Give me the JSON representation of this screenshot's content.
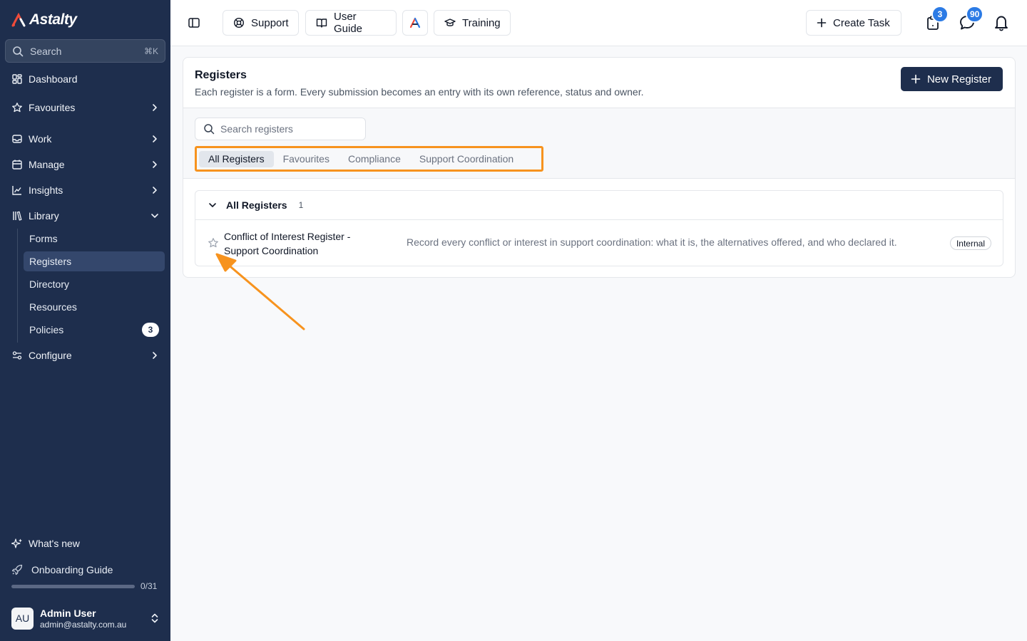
{
  "app": {
    "logo_text": "Astalty"
  },
  "sidebar": {
    "search": {
      "placeholder": "Search",
      "shortcut": "⌘K"
    },
    "items": [
      {
        "label": "Dashboard",
        "icon": "grid-icon"
      },
      {
        "label": "Favourites",
        "icon": "star-icon"
      },
      {
        "label": "Work",
        "icon": "inbox-icon"
      },
      {
        "label": "Manage",
        "icon": "calendar-icon"
      },
      {
        "label": "Insights",
        "icon": "chart-line-icon"
      },
      {
        "label": "Library",
        "icon": "library-icon"
      },
      {
        "label": "Configure",
        "icon": "sliders-icon"
      }
    ],
    "library_sub": [
      {
        "label": "Forms"
      },
      {
        "label": "Registers"
      },
      {
        "label": "Directory"
      },
      {
        "label": "Resources"
      },
      {
        "label": "Policies",
        "count": "3"
      }
    ],
    "whats_new": "What's new",
    "onboarding": {
      "label": "Onboarding Guide",
      "progress_text": "0/31",
      "progress": 0
    },
    "user": {
      "initials": "AU",
      "name": "Admin User",
      "email": "admin@astalty.com.au"
    }
  },
  "topbar": {
    "support": "Support",
    "user_guide": "User Guide",
    "training": "Training",
    "create_task": "Create Task",
    "tasks_badge": "3",
    "messages_badge": "90"
  },
  "page": {
    "title": "Registers",
    "subtitle": "Each register is a form. Every submission becomes an entry with its own reference, status and owner.",
    "new_button": "New Register",
    "search_placeholder": "Search registers",
    "tabs": [
      "All Registers",
      "Favourites",
      "Compliance",
      "Support Coordination"
    ],
    "group": {
      "title": "All Registers",
      "count": "1",
      "rows": [
        {
          "name": "Conflict of Interest Register - Support Coordination",
          "description": "Record every conflict or interest in support coordination: what it is, the alternatives offered, and who declared it.",
          "tag": "Internal"
        }
      ]
    }
  },
  "colors": {
    "sidebar": "#1e2e4d",
    "highlight": "#f7931e",
    "badge": "#2c7be5",
    "primary": "#1e2e4d"
  }
}
